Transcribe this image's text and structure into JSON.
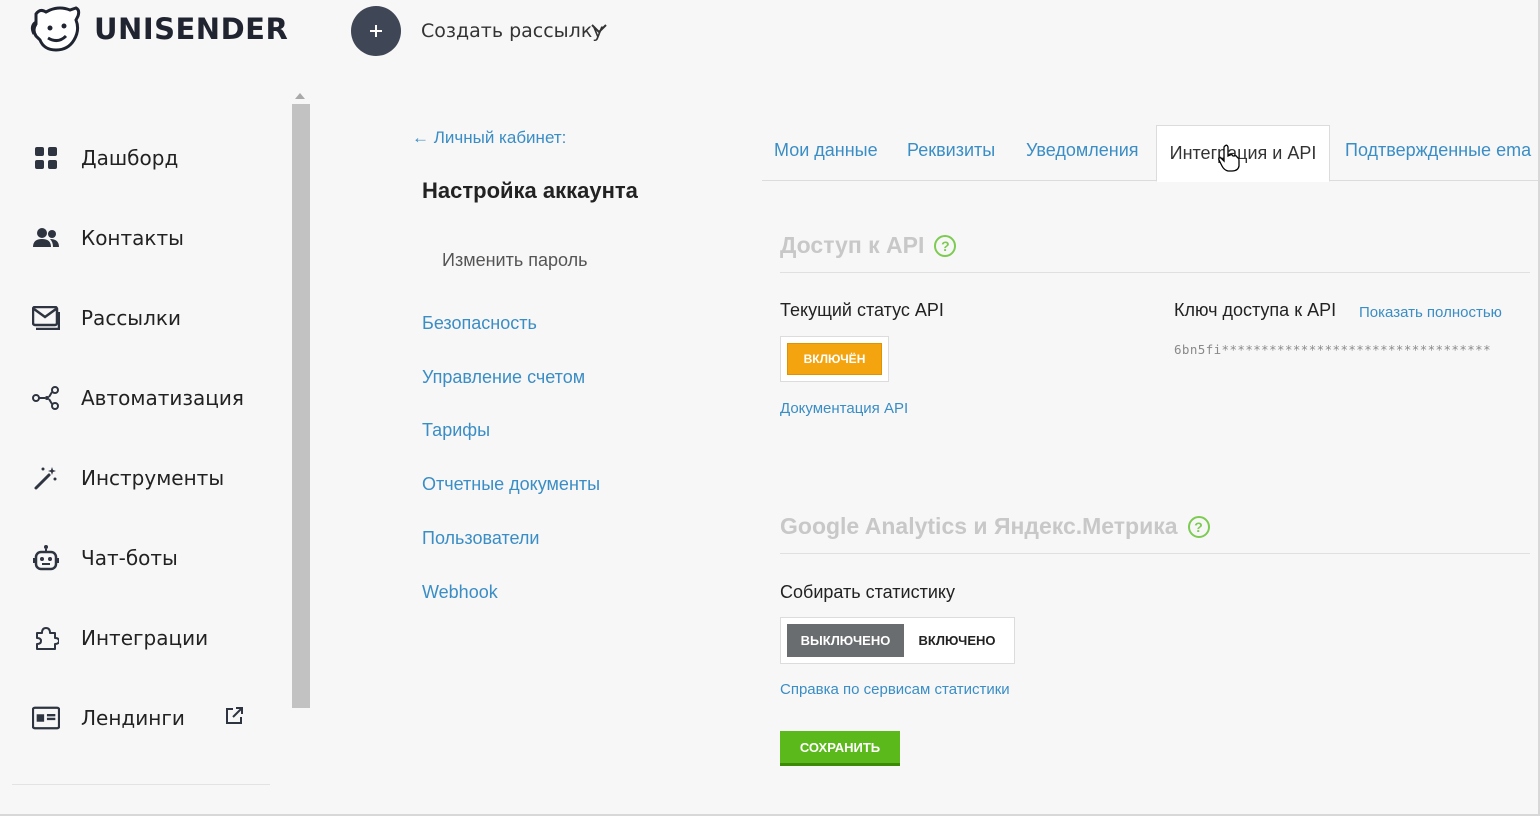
{
  "logo": {
    "text": "UNISENDER"
  },
  "topbar": {
    "create_label": "Создать рассылку"
  },
  "sidebar": {
    "items": [
      {
        "label": "Дашборд",
        "icon": "dashboard-icon"
      },
      {
        "label": "Контакты",
        "icon": "contacts-icon"
      },
      {
        "label": "Рассылки",
        "icon": "mailings-icon"
      },
      {
        "label": "Автоматизация",
        "icon": "automation-icon"
      },
      {
        "label": "Инструменты",
        "icon": "tools-icon"
      },
      {
        "label": "Чат-боты",
        "icon": "chatbot-icon"
      },
      {
        "label": "Интеграции",
        "icon": "integrations-icon"
      },
      {
        "label": "Лендинги",
        "icon": "landings-icon"
      }
    ]
  },
  "settings_nav": {
    "back_link": "← Личный кабинет:",
    "title": "Настройка аккаунта",
    "change_password": "Изменить пароль",
    "links": [
      "Безопасность",
      "Управление счетом",
      "Тарифы",
      "Отчетные документы",
      "Пользователи",
      "Webhook"
    ]
  },
  "tabs": {
    "items": [
      "Мои данные",
      "Реквизиты",
      "Уведомления",
      "Интеграция и API",
      "Подтвержденные ema"
    ],
    "active": "Интеграция и API"
  },
  "api_section": {
    "title": "Доступ к API",
    "status_label": "Текущий статус API",
    "status_value": "ВКЛЮЧЁН",
    "docs_link": "Документация API",
    "key_label": "Ключ доступа к API",
    "show_full": "Показать полностью",
    "key_value": "6bn5fi**********************************"
  },
  "analytics_section": {
    "title": "Google Analytics и Яндекс.Метрика",
    "collect_label": "Собирать статистику",
    "toggle_off": "ВЫКЛЮЧЕНО",
    "toggle_on": "ВКЛЮЧЕНО",
    "help_link": "Справка по сервисам статистики",
    "save_label": "СОХРАНИТЬ"
  },
  "colors": {
    "link": "#3a8dc5",
    "status_on": "#f4a40f",
    "save": "#5cb91b",
    "help": "#7dcb52",
    "dark_button": "#3f4656"
  }
}
